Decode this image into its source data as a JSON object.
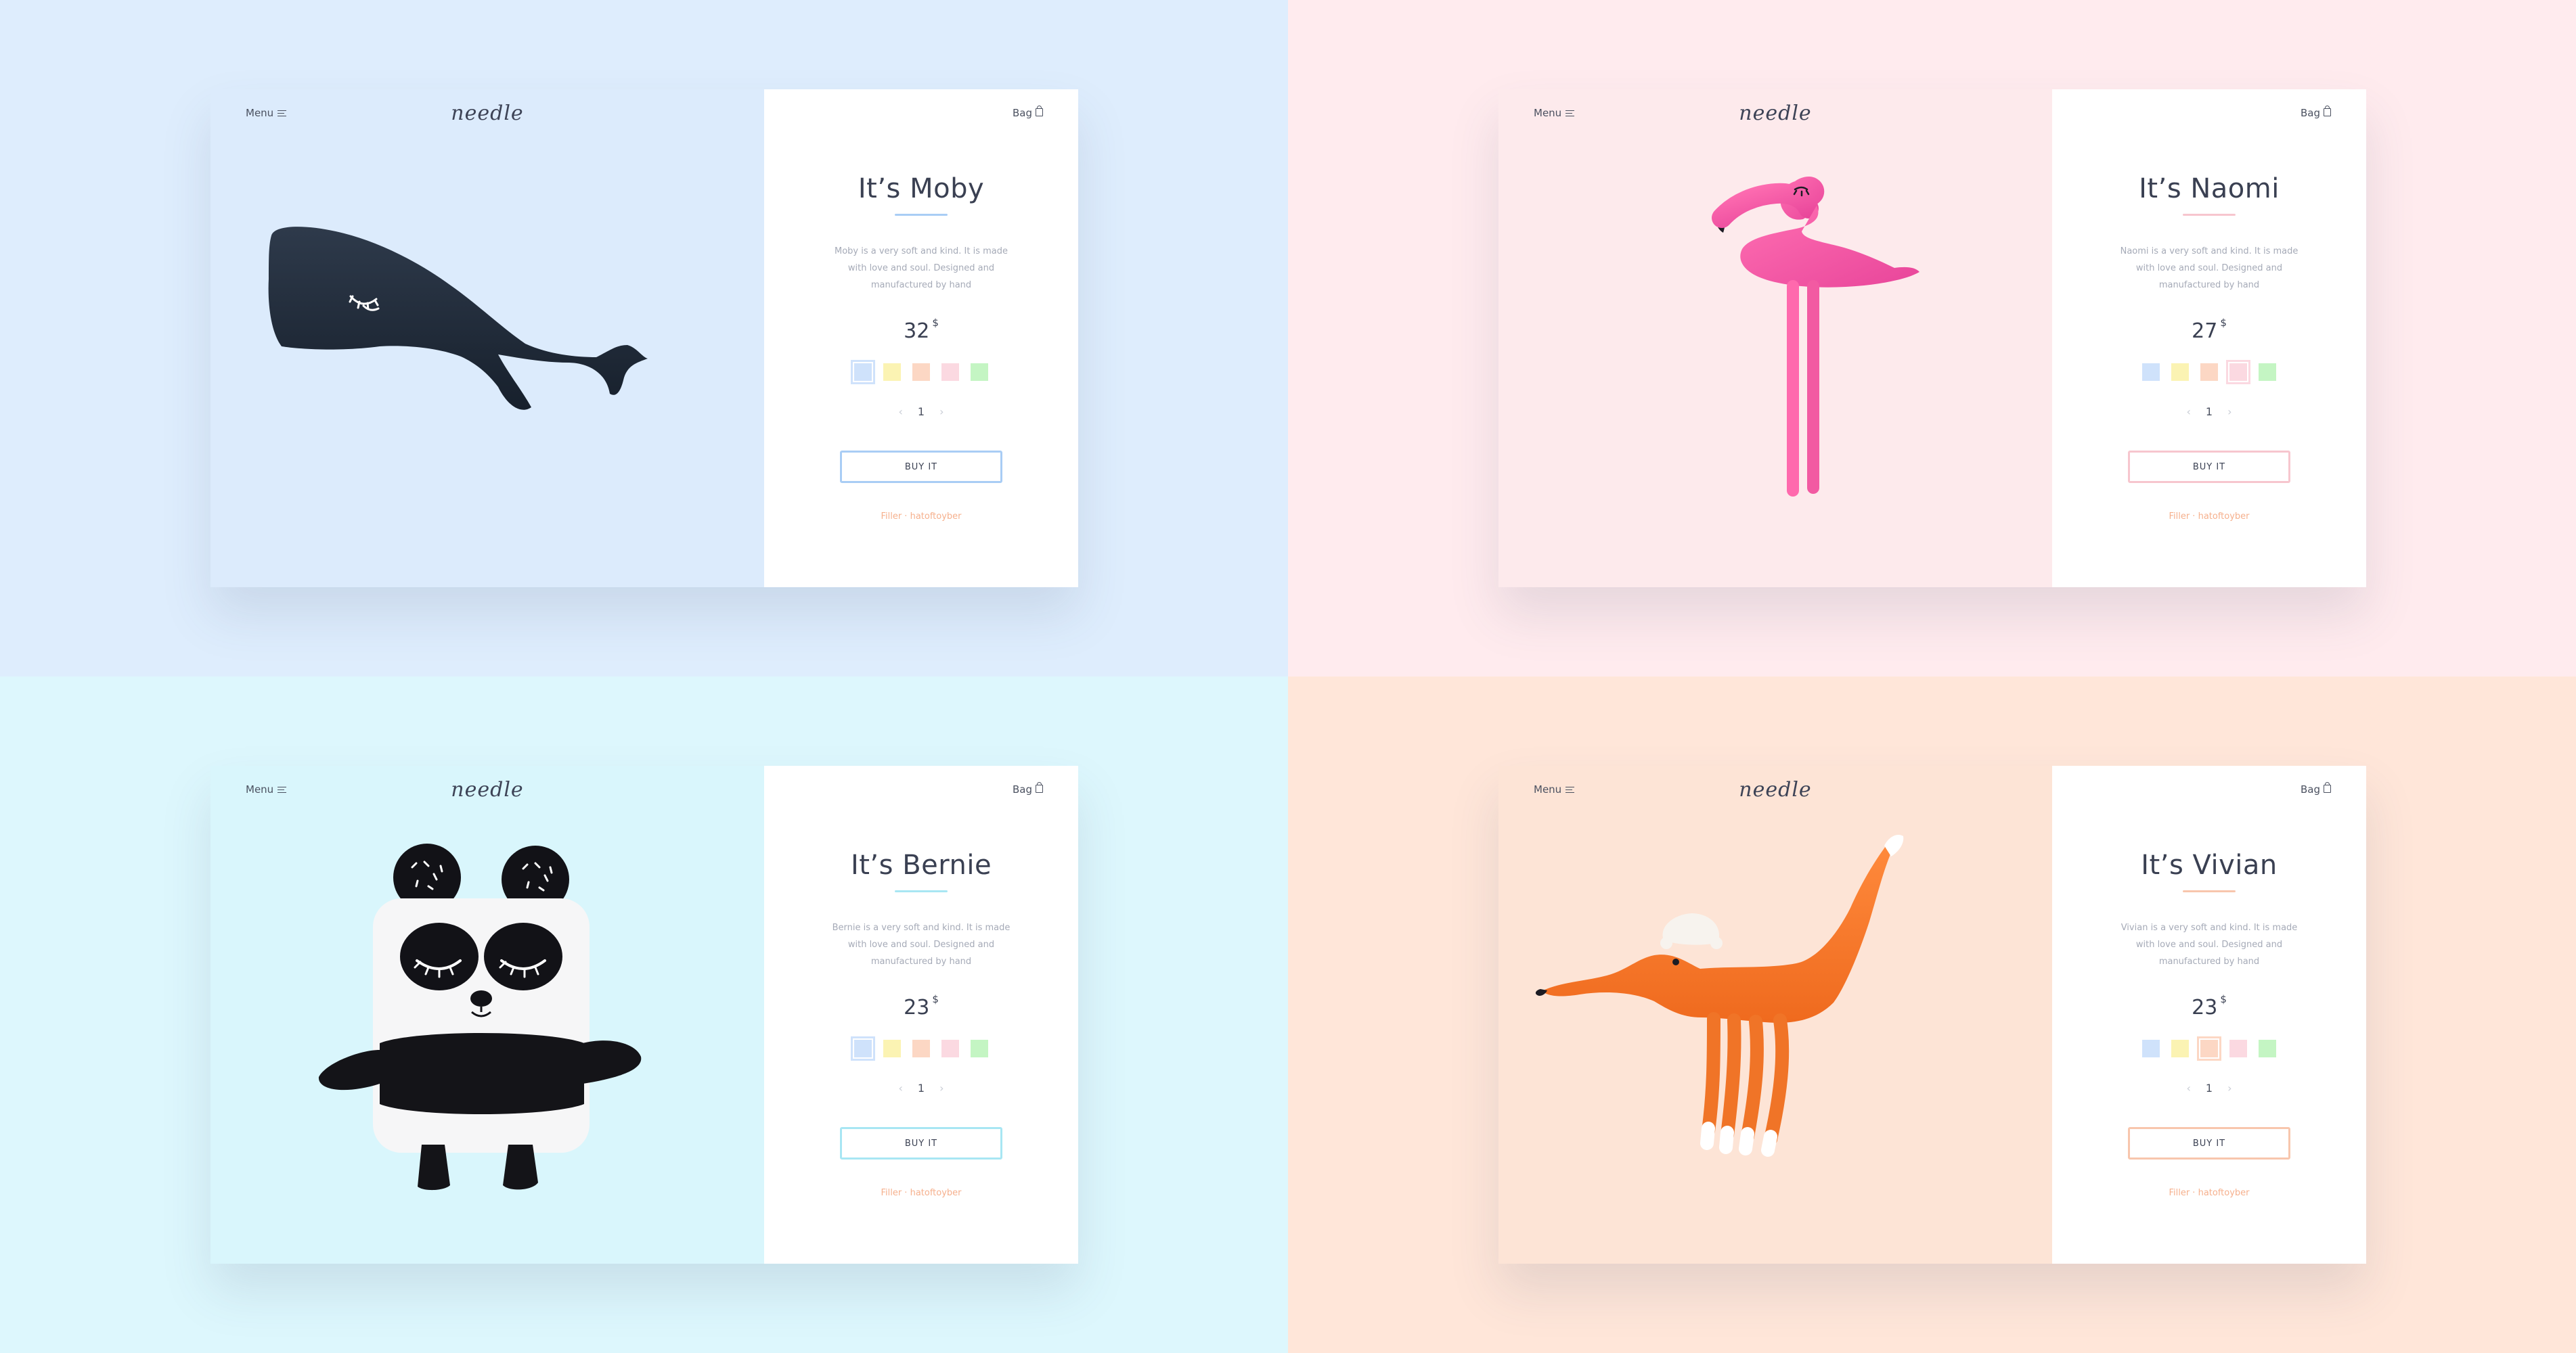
{
  "header": {
    "menu_label": "Menu",
    "logo": "needle",
    "bag_label": "Bag"
  },
  "common": {
    "description_suffix": " is a very soft and kind. It is made with love and soul. Designed and manufactured by hand",
    "buy_label": "BUY IT",
    "credit": "Filler · hatoftoyber",
    "currency": "$",
    "swatch_colors": [
      "#cfe2fb",
      "#fbf3b3",
      "#fcd7c4",
      "#fbd9e1",
      "#c4f5c3"
    ]
  },
  "cards": [
    {
      "name": "Moby",
      "title": "It’s Moby",
      "description": "Moby is a very soft and kind. It is made with love and soul. Designed and manufactured by hand",
      "price": "32",
      "quantity": "1",
      "selected_swatch": 0,
      "bg": "#dcebfc",
      "quadrant_bg": "#deedfd",
      "accent": "#a9cdf5",
      "animal": "whale"
    },
    {
      "name": "Naomi",
      "title": "It’s Naomi",
      "description": "Naomi is a very soft and kind. It is made with love and soul. Designed and manufactured by hand",
      "price": "27",
      "quantity": "1",
      "selected_swatch": 3,
      "bg": "#fdeaec",
      "quadrant_bg": "#ffebee",
      "accent": "#f7c6ce",
      "animal": "flamingo"
    },
    {
      "name": "Bernie",
      "title": "It’s Bernie",
      "description": "Bernie is a very soft and kind. It is made with love and soul. Designed and manufactured by hand",
      "price": "23",
      "quantity": "1",
      "selected_swatch": 0,
      "bg": "#d9f6fc",
      "quadrant_bg": "#ddf7fd",
      "accent": "#a8e6f3",
      "animal": "panda"
    },
    {
      "name": "Vivian",
      "title": "It’s Vivian",
      "description": "Vivian is a very soft and kind. It is made with love and soul. Designed and manufactured by hand",
      "price": "23",
      "quantity": "1",
      "selected_swatch": 2,
      "bg": "#fde4d6",
      "quadrant_bg": "#ffe6d9",
      "accent": "#f8c6ad",
      "animal": "fox"
    }
  ]
}
